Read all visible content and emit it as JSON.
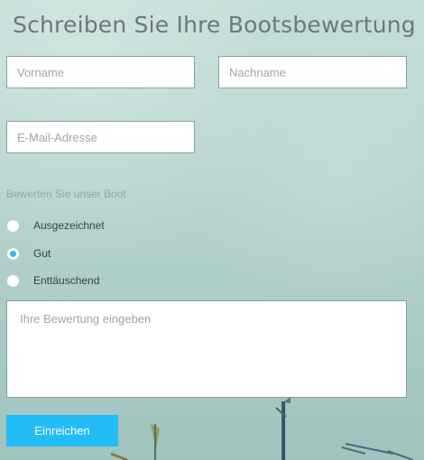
{
  "form": {
    "title": "Schreiben Sie Ihre Bootsbewertung",
    "fields": {
      "first_name_placeholder": "Vorname",
      "last_name_placeholder": "Nachname",
      "email_placeholder": "E-Mail-Adresse"
    },
    "rating": {
      "label": "Bewerten Sie unser Boot",
      "options": [
        {
          "label": "Ausgezeichnet",
          "selected": false
        },
        {
          "label": "Gut",
          "selected": true
        },
        {
          "label": "Enttäuschend",
          "selected": false
        }
      ]
    },
    "review_placeholder": "Ihre Bewertung eingeben",
    "submit_label": "Einreichen"
  },
  "colors": {
    "accent": "#22bdf7",
    "radio_selected": "#36b8e3"
  },
  "icons": {
    "radio_selected": "radio-selected-icon",
    "radio_unselected": "radio-unselected-icon"
  }
}
